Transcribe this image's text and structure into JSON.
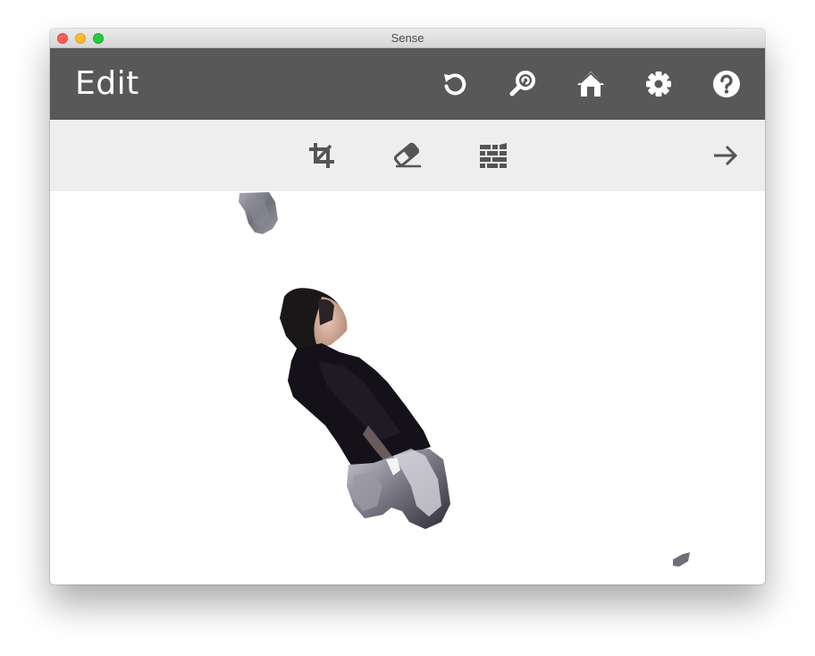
{
  "window": {
    "title": "Sense"
  },
  "header": {
    "title": "Edit",
    "buttons": [
      {
        "name": "undo",
        "icon": "undo-icon"
      },
      {
        "name": "zoom",
        "icon": "zoom-search-icon"
      },
      {
        "name": "home",
        "icon": "home-icon"
      },
      {
        "name": "settings",
        "icon": "gear-icon"
      },
      {
        "name": "help",
        "icon": "help-icon"
      }
    ]
  },
  "toolbar": {
    "tools": [
      {
        "name": "crop",
        "icon": "crop-icon"
      },
      {
        "name": "erase",
        "icon": "eraser-icon"
      },
      {
        "name": "solidify",
        "icon": "brick-wall-icon"
      }
    ],
    "next": {
      "icon": "arrow-right-icon"
    }
  },
  "colors": {
    "header_bg": "#585858",
    "toolbar_bg": "#eeeeee",
    "icon_light": "#ffffff",
    "icon_dark": "#555555"
  }
}
